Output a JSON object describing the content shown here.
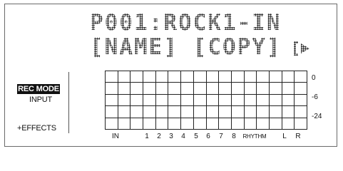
{
  "header": {
    "patch_line": "P001:ROCK1-IN",
    "menu_line": "[NAME] [COPY] "
  },
  "menu": {
    "rec_mode": "REC MODE",
    "input": "INPUT",
    "effects": "+EFFECTS"
  },
  "meter": {
    "db_labels": [
      "0",
      "-6",
      "-24"
    ],
    "channels": [
      "IN",
      "1",
      "2",
      "3",
      "4",
      "5",
      "6",
      "7",
      "8",
      "RHYTHM",
      "L",
      "R"
    ],
    "rows": 5,
    "columns": 16
  },
  "colors": {
    "text": "#111111",
    "lcd": "#1a1a1a",
    "highlight_bg": "#111111",
    "highlight_text": "#ffffff",
    "frame": "#6a6a6a"
  },
  "icons": {
    "scroll_right": "right-arrow-tab-icon"
  }
}
